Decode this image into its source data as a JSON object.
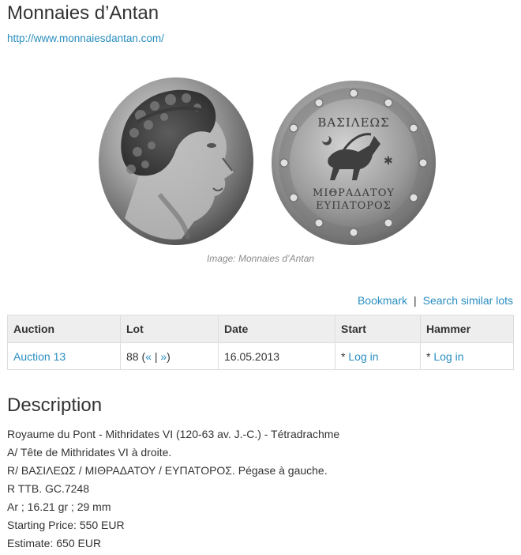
{
  "header": {
    "title": "Monnaies d’Antan",
    "website": "http://www.monnaiesdantan.com/"
  },
  "image": {
    "caption": "Image: Monnaies d’Antan",
    "reverse_legend": [
      "ΒΑΣΙΛΕΩΣ",
      "ΜΙΘΡΑΔΑΤΟΥ",
      "ΕΥΠΑΤΟΡΟΣ"
    ]
  },
  "actions": {
    "bookmark": "Bookmark",
    "separator": "|",
    "search_similar": "Search similar lots"
  },
  "table": {
    "headers": [
      "Auction",
      "Lot",
      "Date",
      "Start",
      "Hammer"
    ],
    "row": {
      "auction": "Auction 13",
      "lot_number": "88",
      "lot_prev": "«",
      "lot_sep": "|",
      "lot_next": "»",
      "date": "16.05.2013",
      "start_prefix": "* ",
      "start_link": "Log in",
      "hammer_prefix": "* ",
      "hammer_link": "Log in"
    }
  },
  "description": {
    "heading": "Description",
    "lines": [
      "Royaume du Pont - Mithridates VI (120-63 av. J.-C.) - Tétradrachme",
      "A/ Tête de Mithridates VI à droite.",
      "R/ ΒΑΣΙΛΕΩΣ / ΜΙΘΡΑΔΑΤΟΥ / ΕΥΠΑΤΟΡΟΣ. Pégase à gauche.",
      "R TTB. GC.7248",
      "Ar ; 16.21 gr ; 29 mm",
      "Starting Price: 550 EUR",
      "Estimate: 650 EUR"
    ]
  },
  "colors": {
    "link": "#2a8ec0",
    "text": "#333333",
    "table_header_bg": "#eeeeee",
    "caption": "#8a8a8a"
  }
}
